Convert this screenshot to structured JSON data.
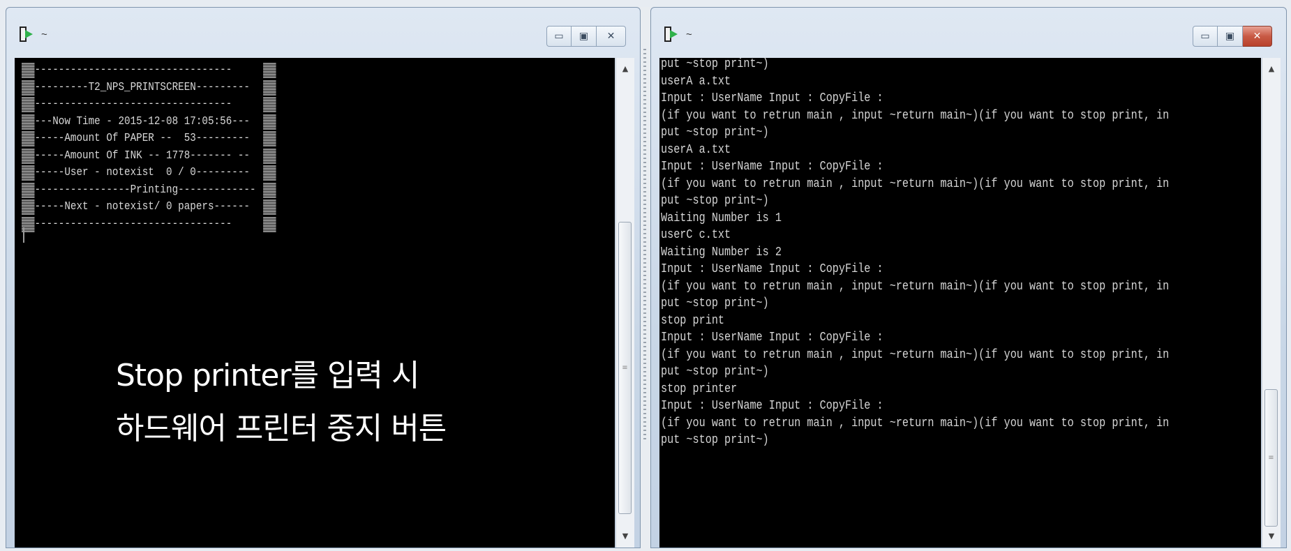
{
  "left_window": {
    "title": "~",
    "controls": {
      "minimize": "▭",
      "maximize": "▣",
      "close": "✕"
    },
    "banner_lines": [
      "---------------------------------",
      "---------T2_NPS_PRINTSCREEN---------",
      "---------------------------------",
      "---Now Time - 2015-12-08 17:05:56---",
      "-----Amount Of PAPER --  53---------",
      "-----Amount Of INK -- 1778------- --",
      "-----User - notexist  0 / 0---------",
      "----------------Printing-------------",
      "-----Next - notexist/ 0 papers------",
      "---------------------------------"
    ],
    "overlay_line1": "Stop printer를 입력 시",
    "overlay_line2": "하드웨어 프린터 중지 버튼",
    "scroll_up": "▲",
    "scroll_down": "▼"
  },
  "right_window": {
    "title": "~",
    "controls": {
      "minimize": "▭",
      "maximize": "▣",
      "close": "✕"
    },
    "log_lines": [
      "put ~stop print~)",
      "userA a.txt",
      "Input : UserName Input : CopyFile :",
      "(if you want to retrun main , input ~return main~)(if you want to stop print, in",
      "put ~stop print~)",
      "userA a.txt",
      "Input : UserName Input : CopyFile :",
      "(if you want to retrun main , input ~return main~)(if you want to stop print, in",
      "put ~stop print~)",
      "Waiting Number is 1",
      "userC c.txt",
      "Waiting Number is 2",
      "Input : UserName Input : CopyFile :",
      "(if you want to retrun main , input ~return main~)(if you want to stop print, in",
      "put ~stop print~)",
      "stop print",
      "Input : UserName Input : CopyFile :",
      "(if you want to retrun main , input ~return main~)(if you want to stop print, in",
      "put ~stop print~)",
      "stop printer",
      "Input : UserName Input : CopyFile :",
      "(if you want to retrun main , input ~return main~)(if you want to stop print, in",
      "put ~stop print~)"
    ],
    "scroll_up": "▲",
    "scroll_down": "▼"
  },
  "colors": {
    "console_bg": "#000000",
    "console_text": "#d6d6d6",
    "overlay_text": "#ffffff",
    "close_button": "#c85a45",
    "app_icon": "#2fb14a"
  }
}
